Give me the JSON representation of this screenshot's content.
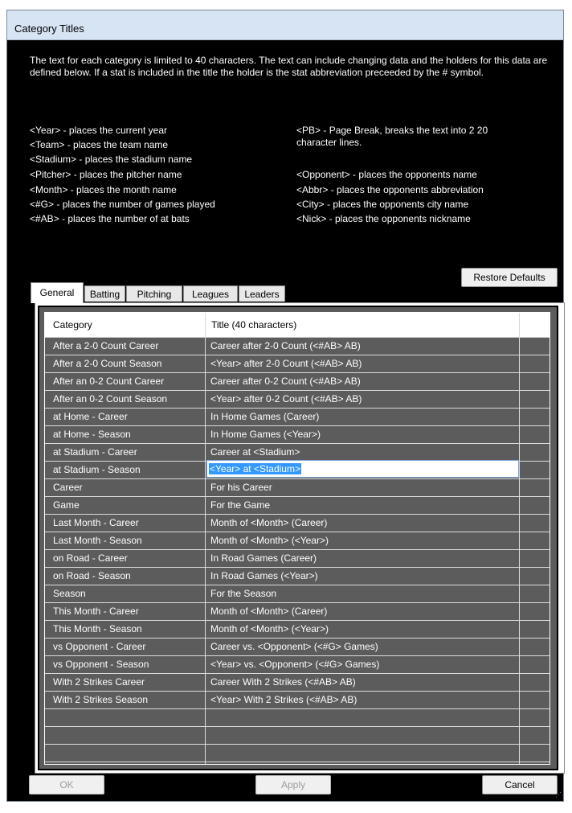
{
  "window": {
    "title": "Category Titles"
  },
  "description": "The text for each category is limited to 40 characters.  The text can include changing data and the holders for this data are defined below.  If a stat is included in the title the holder is the stat abbreviation preceeded by the # symbol.",
  "holders_left": [
    "<Year> - places the current year",
    "<Team> - places the team name",
    "<Stadium> - places the stadium name",
    "<Pitcher> - places the pitcher name",
    "<Month> - places the month name",
    "<#G> - places the number of games played",
    "<#AB> - places the number of at bats"
  ],
  "holders_right": [
    "<PB> - Page Break, breaks the text into 2 20",
    "character lines.",
    "<Opponent> - places the opponents name",
    "<Abbr> - places the opponents abbreviation",
    "<City> - places the opponents city name",
    "<Nick> - places the opponents nickname"
  ],
  "tabs": [
    {
      "label": "General",
      "active": true
    },
    {
      "label": "Batting"
    },
    {
      "label": "Pitching"
    },
    {
      "label": "Leagues"
    },
    {
      "label": "Leaders"
    }
  ],
  "restore_label": "Restore Defaults",
  "table": {
    "headers": [
      "Category",
      "Title (40 characters)"
    ],
    "rows": [
      [
        "After a 2-0 Count Career",
        "Career after 2-0 Count (<#AB> AB)"
      ],
      [
        "After a 2-0 Count Season",
        "<Year> after 2-0 Count (<#AB> AB)"
      ],
      [
        "After an 0-2 Count Career",
        "Career after 0-2 Count (<#AB> AB)"
      ],
      [
        "After an 0-2 Count Season",
        "<Year> after 0-2 Count (<#AB> AB)"
      ],
      [
        "at Home - Career",
        "In Home Games (Career)"
      ],
      [
        "at Home - Season",
        "In Home Games (<Year>)"
      ],
      [
        "at Stadium - Career",
        "Career at <Stadium>"
      ],
      [
        "at Stadium - Season",
        "<Year> at <Stadium>"
      ],
      [
        "Career",
        "For his Career"
      ],
      [
        "Game",
        "For the Game"
      ],
      [
        "Last Month - Career",
        "Month of <Month> (Career)"
      ],
      [
        "Last Month - Season",
        "Month of <Month> (<Year>)"
      ],
      [
        "on Road - Career",
        "In Road Games (Career)"
      ],
      [
        "on Road - Season",
        "In Road Games (<Year>)"
      ],
      [
        "Season",
        "For the Season"
      ],
      [
        "This Month - Career",
        "Month of <Month> (Career)"
      ],
      [
        "This Month - Season",
        "Month of <Month> (<Year>)"
      ],
      [
        "vs Opponent - Career",
        "Career vs. <Opponent> (<#G> Games)"
      ],
      [
        "vs Opponent - Season",
        "<Year> vs. <Opponent> (<#G> Games)"
      ],
      [
        "With 2 Strikes Career",
        "Career With 2 Strikes (<#AB> AB)"
      ],
      [
        "With 2 Strikes Season",
        "<Year> With 2 Strikes (<#AB> AB)"
      ]
    ],
    "editing_row": 7,
    "empty_rows": 4
  },
  "buttons": {
    "ok": "OK",
    "apply": "Apply",
    "cancel": "Cancel"
  }
}
